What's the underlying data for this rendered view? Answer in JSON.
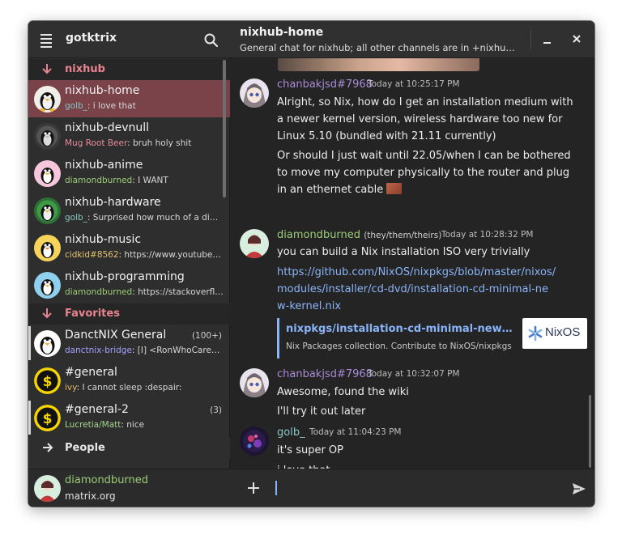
{
  "colors": {
    "accent": "#7a4249",
    "section_label": "#e8838f",
    "link": "#8ab4f8",
    "user_chanbakjsd": "#a98bd6",
    "user_diamondburned": "#9ccc78",
    "user_golb": "#88c7c4",
    "user_mug": "#e88aa0",
    "user_cidkid": "#e6c36e",
    "user_danctnix": "#a3a0ff",
    "user_ivy": "#e6b85c",
    "user_lucretia": "#a6d48a"
  },
  "sidebar": {
    "title": "gotktrix",
    "menu_icon": "hamburger-icon",
    "search_icon": "search-icon",
    "sections": [
      {
        "label": "nixhub",
        "rooms": [
          {
            "name": "nixhub-home",
            "sender": "golb_",
            "message": ": i love that",
            "active": true
          },
          {
            "name": "nixhub-devnull",
            "sender": "Mug Root Beer",
            "message": ": bruh holy shit"
          },
          {
            "name": "nixhub-anime",
            "sender": "diamondburned",
            "message": ": I WANT"
          },
          {
            "name": "nixhub-hardware",
            "sender": "golb_",
            "message": ": Surprised how much of a difference"
          },
          {
            "name": "nixhub-music",
            "sender": "cidkid#8562",
            "message": ": https://www.youtube.com/watch"
          },
          {
            "name": "nixhub-programming",
            "sender": "diamondburned",
            "message": ": https://stackoverflow.com/"
          }
        ]
      },
      {
        "label": "Favorites",
        "rooms": [
          {
            "name": "DanctNIX General",
            "count": "(100+)",
            "sender": "danctnix-bridge",
            "message": ": [I] <RonWhoCares> :)"
          },
          {
            "name": "#general",
            "sender": "ivy",
            "message": ": I cannot sleep :despair:"
          },
          {
            "name": "#general-2",
            "count": "(3)",
            "sender": "Lucretia/Matt",
            "message": ": nice"
          }
        ]
      },
      {
        "label": "People"
      }
    ],
    "footer": {
      "username": "diamondburned",
      "server": "matrix.org"
    }
  },
  "header": {
    "title": "nixhub-home",
    "topic": "General chat for nixhub; all other channels are in +nixhub:matrix.org",
    "minimize_icon": "minimize-icon",
    "close_icon": "close-icon"
  },
  "messages": [
    {
      "sender": "chanbakjsd#7968",
      "timestamp": "Today at 10:25:17 PM",
      "lines": [
        "Alright, so Nix, how do I get an installation medium with a newer kernel version, wireless hardware too new for Linux 5.10 (bundled with 21.11 currently)",
        "Or should I just wait until 22.05/when I can be bothered to move my computer physically to the router and plug in an ethernet cable"
      ]
    },
    {
      "sender": "diamondburned",
      "pronouns": "(they/them/theirs)",
      "timestamp": "Today at 10:28:32 PM",
      "lines": [
        "you can build a Nix installation ISO very trivially",
        "https://github.com/NixOS/nixpkgs/blob/master/nixos/modules/installer/cd-dvd/installation-cd-minimal-new-kernel.nix"
      ],
      "link_preview": {
        "title": "nixpkgs/installation-cd-minimal-new-kernel.nix at master",
        "description": "Nix Packages collection. Contribute to NixOS/nixpkgs",
        "logo_text": "NixOS"
      }
    },
    {
      "sender": "chanbakjsd#7968",
      "timestamp": "Today at 10:32:07 PM",
      "lines": [
        "Awesome, found the wiki",
        "I'll try it out later"
      ]
    },
    {
      "sender": "golb_",
      "timestamp": "Today at 11:04:23 PM",
      "lines": [
        "it's super OP",
        "i love that"
      ]
    }
  ],
  "composer": {
    "add_icon": "plus-icon",
    "send_icon": "send-icon",
    "placeholder": ""
  }
}
